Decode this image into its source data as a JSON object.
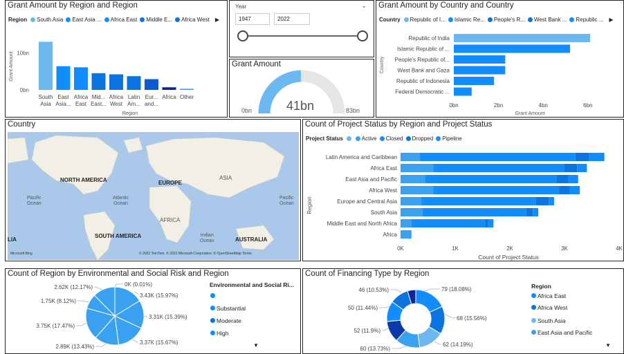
{
  "colors": {
    "lightblue": "#6CB8F0",
    "blue": "#118DFF",
    "mid": "#0B74E0",
    "dark": "#12239E",
    "navy": "#0B3AA8",
    "sky": "#3AA0F0"
  },
  "panel1": {
    "title": "Grant Amount by Region and Region",
    "legend_title": "Region",
    "legend": [
      "South Asia",
      "East Asia ...",
      "Africa East",
      "Middle E...",
      "Africa West"
    ],
    "ylabel": "Grant Amount",
    "xlabel": "Region"
  },
  "slicer": {
    "label": "Year",
    "from": "1947",
    "to": "2022"
  },
  "gauge": {
    "title": "Grant Amount",
    "min": "0bn",
    "max": "83bn",
    "value_label": "41bn",
    "value": 41,
    "maximum": 83
  },
  "panel3": {
    "title": "Grant Amount by Country and Country",
    "legend_title": "Country",
    "legend": [
      "Republic of I...",
      "Islamic Re...",
      "People's R...",
      "West Bank ...",
      "Republic ..."
    ],
    "ylabel": "Country",
    "xlabel": "Grant Amount"
  },
  "map": {
    "title": "Country",
    "labels": {
      "north_america": "NORTH AMERICA",
      "europe": "EUROPE",
      "asia": "ASIA",
      "africa": "AFRICA",
      "south_america": "SOUTH AMERICA",
      "australia": "AUSTRALIA",
      "pacific_left": "Pacific\nOcean",
      "atlantic": "Atlantic\nOcean",
      "indian": "Indian\nOcean",
      "pacific_right": "Pacific\nOcean",
      "lia": "LIA"
    },
    "logo": "Microsoft Bing",
    "copyright": "© 2022 TomTom, © 2022 Microsoft Corporation, © OpenStreetMap  Terms"
  },
  "panel5": {
    "title": "Count of Project Status by Region and Project Status",
    "legend_title": "Project Status",
    "legend": [
      "",
      "Active",
      "Closed",
      "Dropped",
      "Pipeline"
    ],
    "ylabel": "Region",
    "xlabel": "Count of Project Status"
  },
  "panel6": {
    "title": "Count of Region by Environmental and Social Risk and Region",
    "legend_title": "Environmental and Social Ri...",
    "legend": [
      "",
      "Substantial",
      "Moderate",
      "High"
    ]
  },
  "panel7": {
    "title": "Count of Financing Type by Region",
    "legend_title": "Region",
    "legend": [
      "Africa East",
      "Africa West",
      "South Asia",
      "East Asia and Pacific"
    ]
  },
  "chart_data": [
    {
      "id": "grant_by_region",
      "type": "bar",
      "title": "Grant Amount by Region and Region",
      "categories": [
        "South Asia",
        "East Asia...",
        "Africa East",
        "Mid... East...",
        "Africa West",
        "Latin Am...",
        "Eur... and...",
        "Africa",
        "Other"
      ],
      "values": [
        13.0,
        6.4,
        6.1,
        4.5,
        4.2,
        3.7,
        2.9,
        0.7,
        0.3
      ],
      "colors": [
        "#6CB8F0",
        "#118DFF",
        "#118DFF",
        "#0B74E0",
        "#0B74E0",
        "#0B74E0",
        "#0B5BD0",
        "#12239E",
        "#3AA0F0"
      ],
      "ylabel": "Grant Amount",
      "xlabel": "Region",
      "yticks": [
        "0bn",
        "10bn"
      ],
      "ylim": [
        0,
        14
      ]
    },
    {
      "id": "grant_by_country",
      "type": "bar",
      "orientation": "horizontal",
      "title": "Grant Amount by Country and Country",
      "categories": [
        "Republic of India",
        "Islamic Republic of ...",
        "People's Republic of...",
        "West Bank and Gaza",
        "Republic of Indonesia",
        "Federal Democratic ..."
      ],
      "values": [
        6.1,
        5.2,
        2.3,
        2.3,
        1.8,
        0.8
      ],
      "colors": [
        "#6CB8F0",
        "#118DFF",
        "#118DFF",
        "#118DFF",
        "#118DFF",
        "#118DFF"
      ],
      "xticks": [
        "0bn",
        "2bn",
        "4bn",
        "6bn"
      ],
      "xlim": [
        0,
        6.5
      ],
      "xlabel": "Grant Amount",
      "ylabel": "Country"
    },
    {
      "id": "project_status",
      "type": "bar",
      "orientation": "horizontal",
      "stacked": true,
      "title": "Count of Project Status by Region and Project Status",
      "categories": [
        "Latin America and Caribbean",
        "Africa East",
        "East Asia and Pacific",
        "Africa West",
        "Europe and Central Asia",
        "South Asia",
        "Middle East and North Africa",
        "Africa"
      ],
      "series": [
        {
          "name": "",
          "color": "#6CB8F0",
          "values": [
            0,
            0,
            0,
            0,
            0,
            0,
            0,
            0
          ]
        },
        {
          "name": "Active",
          "color": "#3AA0F0",
          "values": [
            350,
            600,
            450,
            600,
            380,
            400,
            200,
            200
          ]
        },
        {
          "name": "Closed",
          "color": "#118DFF",
          "values": [
            2850,
            2400,
            2400,
            2300,
            2100,
            1900,
            1350,
            0
          ]
        },
        {
          "name": "Dropped",
          "color": "#0B74E0",
          "values": [
            250,
            230,
            220,
            200,
            230,
            120,
            50,
            0
          ]
        },
        {
          "name": "Pipeline",
          "color": "#118DFF",
          "values": [
            280,
            180,
            180,
            180,
            100,
            100,
            100,
            0
          ]
        }
      ],
      "xticks": [
        "0K",
        "1K",
        "2K",
        "3K",
        "4K"
      ],
      "xlim": [
        0,
        4000
      ],
      "xlabel": "Count of Project Status",
      "ylabel": "Region"
    },
    {
      "id": "env_risk",
      "type": "pie",
      "title": "Count of Region by Environmental and Social Risk and Region",
      "slices": [
        {
          "label": "0K (0.01%)",
          "value": 0.01
        },
        {
          "label": "3.43K (15.97%)",
          "value": 15.97
        },
        {
          "label": "3.31K (15.39%)",
          "value": 15.39
        },
        {
          "label": "3.37K (15.67%)",
          "value": 15.67
        },
        {
          "label": "2.89K (13.43%)",
          "value": 13.43
        },
        {
          "label": "3.75K (17.47%)",
          "value": 17.47
        },
        {
          "label": "1.75K (8.12%)",
          "value": 8.12
        },
        {
          "label": "2.62K (12.17%)",
          "value": 12.17
        }
      ],
      "color": "#3AA0F0"
    },
    {
      "id": "financing_type",
      "type": "pie",
      "donut": true,
      "title": "Count of Financing Type by Region",
      "slices": [
        {
          "label": "79 (18.08%)",
          "value": 18.08,
          "color": "#118DFF"
        },
        {
          "label": "68 (15.56%)",
          "value": 15.56,
          "color": "#0B74E0"
        },
        {
          "label": "62 (14.19%)",
          "value": 14.19,
          "color": "#6CB8F0"
        },
        {
          "label": "60 (13.73%)",
          "value": 13.73,
          "color": "#3AA0F0"
        },
        {
          "label": "52 (11.9%)",
          "value": 11.9,
          "color": "#0B3AA8"
        },
        {
          "label": "50 (11.44%)",
          "value": 11.44,
          "color": "#118DFF"
        },
        {
          "label": "46 (10.53%)",
          "value": 10.53,
          "color": "#0B74E0"
        },
        {
          "label": "",
          "value": 4.57,
          "color": "#12239E"
        }
      ]
    }
  ]
}
